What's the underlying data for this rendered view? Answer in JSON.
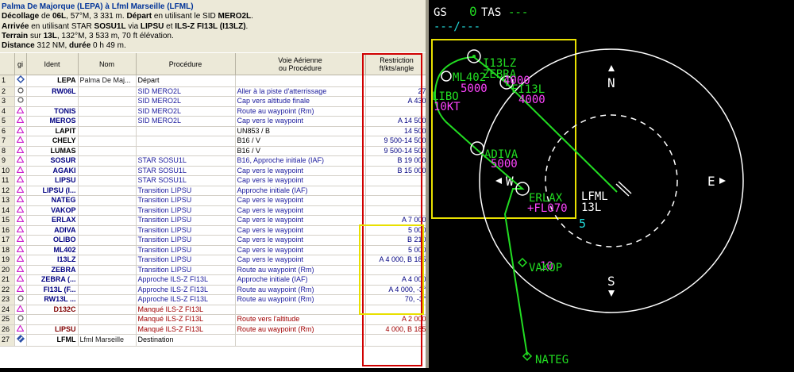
{
  "flightplan": {
    "title": "Palma De Majorque (LEPA) à Lfml Marseille (LFML)",
    "departure": {
      "label": "Décollage",
      "pre": " de ",
      "runway": "06L",
      "info": ", 57°M, 3 331 m. ",
      "label2": "Départ",
      "info2": " en utilisant le SID ",
      "sid": "MERO2L",
      "end": "."
    },
    "arrival": {
      "label": "Arrivée",
      "pre": " en utilisant STAR ",
      "star": "SOSU1L",
      "mid": " via ",
      "via": "LIPSU",
      "and": " et ",
      "approach": "ILS-Z FI13L (I13LZ)",
      "end": "."
    },
    "terrain": {
      "label": "Terrain",
      "pre": " sur ",
      "runway": "13L",
      "info": ", 132°M, 3 533 m, 70 ft élévation."
    },
    "distance": {
      "label": "Distance",
      "value": " 312 NM, ",
      "label2": "durée",
      "value2": " 0 h 49 m."
    }
  },
  "columns": {
    "idx": "",
    "icon": "gi",
    "ident": "Ident",
    "nom": "Nom",
    "procedure": "Procédure",
    "voie1": "Voie Aérienne",
    "voie2": "ou Procédure",
    "restr1": "Restriction",
    "restr2": "ft/kts/angle"
  },
  "rows": [
    {
      "n": "1",
      "icon": "diamond",
      "ident": "LEPA",
      "nom": "Palma De Maj...",
      "proc": "Départ",
      "voie": "",
      "restr": "",
      "pc": "black",
      "vc": "blue",
      "ic": "bk"
    },
    {
      "n": "2",
      "icon": "circle",
      "ident": "RW06L",
      "nom": "",
      "proc": "SID MERO2L",
      "voie": "Aller à la piste d'atterrissage",
      "restr": "27",
      "pc": "blue",
      "vc": "blue",
      "ic": ""
    },
    {
      "n": "3",
      "icon": "circle",
      "ident": "",
      "nom": "",
      "proc": "SID MERO2L",
      "voie": "Cap vers altitude finale",
      "restr": "A 430",
      "pc": "blue",
      "vc": "blue",
      "ic": ""
    },
    {
      "n": "4",
      "icon": "tri",
      "ident": "TONIS",
      "nom": "",
      "proc": "SID MERO2L",
      "voie": "Route au waypoint (Rm)",
      "restr": "",
      "pc": "blue",
      "vc": "blue",
      "ic": ""
    },
    {
      "n": "5",
      "icon": "tri",
      "ident": "MEROS",
      "nom": "",
      "proc": "SID MERO2L",
      "voie": "Cap vers le waypoint",
      "restr": "A 14 500",
      "pc": "blue",
      "vc": "blue",
      "ic": ""
    },
    {
      "n": "6",
      "icon": "tri",
      "ident": "LAPIT",
      "nom": "",
      "proc": "",
      "voie": "UN853 / B",
      "restr": "14 500",
      "pc": "black",
      "vc": "black",
      "ic": "bk"
    },
    {
      "n": "7",
      "icon": "tri",
      "ident": "CHELY",
      "nom": "",
      "proc": "",
      "voie": "B16 / V",
      "restr": "9 500-14 500",
      "pc": "black",
      "vc": "black",
      "ic": "bk"
    },
    {
      "n": "8",
      "icon": "tri",
      "ident": "LUMAS",
      "nom": "",
      "proc": "",
      "voie": "B16 / V",
      "restr": "9 500-14 500",
      "pc": "black",
      "vc": "black",
      "ic": "bk"
    },
    {
      "n": "9",
      "icon": "tri",
      "ident": "SOSUR",
      "nom": "",
      "proc": "STAR SOSU1L",
      "voie": "B16, Approche initiale (IAF)",
      "restr": "B 19 000",
      "pc": "blue",
      "vc": "blue",
      "ic": ""
    },
    {
      "n": "10",
      "icon": "tri",
      "ident": "AGAKI",
      "nom": "",
      "proc": "STAR SOSU1L",
      "voie": "Cap vers le waypoint",
      "restr": "B 15 000",
      "pc": "blue",
      "vc": "blue",
      "ic": ""
    },
    {
      "n": "11",
      "icon": "tri",
      "ident": "LIPSU",
      "nom": "",
      "proc": "STAR SOSU1L",
      "voie": "Cap vers le waypoint",
      "restr": "",
      "pc": "blue",
      "vc": "blue",
      "ic": ""
    },
    {
      "n": "12",
      "icon": "tri",
      "ident": "LIPSU (I...",
      "nom": "",
      "proc": "Transition LIPSU",
      "voie": "Approche initiale (IAF)",
      "restr": "",
      "pc": "blue",
      "vc": "blue",
      "ic": ""
    },
    {
      "n": "13",
      "icon": "tri",
      "ident": "NATEG",
      "nom": "",
      "proc": "Transition LIPSU",
      "voie": "Cap vers le waypoint",
      "restr": "",
      "pc": "blue",
      "vc": "blue",
      "ic": ""
    },
    {
      "n": "14",
      "icon": "tri",
      "ident": "VAKOP",
      "nom": "",
      "proc": "Transition LIPSU",
      "voie": "Cap vers le waypoint",
      "restr": "",
      "pc": "blue",
      "vc": "blue",
      "ic": ""
    },
    {
      "n": "15",
      "icon": "tri",
      "ident": "ERLAX",
      "nom": "",
      "proc": "Transition LIPSU",
      "voie": "Cap vers le waypoint",
      "restr": "A 7 000",
      "pc": "blue",
      "vc": "blue",
      "ic": ""
    },
    {
      "n": "16",
      "icon": "tri",
      "ident": "ADIVA",
      "nom": "",
      "proc": "Transition LIPSU",
      "voie": "Cap vers le waypoint",
      "restr": "5 000",
      "pc": "blue",
      "vc": "blue",
      "ic": ""
    },
    {
      "n": "17",
      "icon": "tri",
      "ident": "OLIBO",
      "nom": "",
      "proc": "Transition LIPSU",
      "voie": "Cap vers le waypoint",
      "restr": "B 210",
      "pc": "blue",
      "vc": "blue",
      "ic": ""
    },
    {
      "n": "18",
      "icon": "tri",
      "ident": "ML402",
      "nom": "",
      "proc": "Transition LIPSU",
      "voie": "Cap vers le waypoint",
      "restr": "5 000",
      "pc": "blue",
      "vc": "blue",
      "ic": ""
    },
    {
      "n": "19",
      "icon": "tri",
      "ident": "I13LZ",
      "nom": "",
      "proc": "Transition LIPSU",
      "voie": "Cap vers le waypoint",
      "restr": "A 4 000, B 185",
      "pc": "blue",
      "vc": "blue",
      "ic": ""
    },
    {
      "n": "20",
      "icon": "tri",
      "ident": "ZEBRA",
      "nom": "",
      "proc": "Transition LIPSU",
      "voie": "Route au waypoint (Rm)",
      "restr": "",
      "pc": "blue",
      "vc": "blue",
      "ic": ""
    },
    {
      "n": "21",
      "icon": "tri",
      "ident": "ZEBRA (...",
      "nom": "",
      "proc": "Approche ILS-Z FI13L",
      "voie": "Approche initiale (IAF)",
      "restr": "A 4 000",
      "pc": "blue",
      "vc": "blue",
      "ic": ""
    },
    {
      "n": "22",
      "icon": "tri",
      "ident": "FI13L (F...",
      "nom": "",
      "proc": "Approche ILS-Z FI13L",
      "voie": "Route au waypoint (Rm)",
      "restr": "A 4 000, -3°",
      "pc": "blue",
      "vc": "blue",
      "ic": ""
    },
    {
      "n": "23",
      "icon": "circle",
      "ident": "RW13L ...",
      "nom": "",
      "proc": "Approche ILS-Z FI13L",
      "voie": "Route au waypoint (Rm)",
      "restr": "70, -3°",
      "pc": "blue",
      "vc": "blue",
      "ic": ""
    },
    {
      "n": "24",
      "icon": "tri",
      "ident": "D132C",
      "nom": "",
      "proc": "Manqué ILS-Z FI13L",
      "voie": "",
      "restr": "",
      "pc": "red",
      "vc": "red",
      "ic": "dk"
    },
    {
      "n": "25",
      "icon": "circle",
      "ident": "",
      "nom": "",
      "proc": "Manqué ILS-Z FI13L",
      "voie": "Route vers l'altitude",
      "restr": "A 2 000",
      "pc": "red",
      "vc": "red",
      "ic": "dk"
    },
    {
      "n": "26",
      "icon": "tri",
      "ident": "LIPSU",
      "nom": "",
      "proc": "Manqué ILS-Z FI13L",
      "voie": "Route au waypoint (Rm)",
      "restr": "4 000, B 185",
      "pc": "red",
      "vc": "red",
      "ic": "dk"
    },
    {
      "n": "27",
      "icon": "airport",
      "ident": "LFML",
      "nom": "Lfml Marseille",
      "proc": "Destination",
      "voie": "",
      "restr": "",
      "pc": "black",
      "vc": "black",
      "ic": "bk"
    }
  ],
  "nd": {
    "gs_label": "GS",
    "gs_value": "0",
    "tas_label": "TAS",
    "tas_value": "---",
    "wind": "---/---",
    "compass": {
      "n": "N",
      "e": "E",
      "s": "S",
      "w": "W"
    },
    "range_ring": "5",
    "airport": "LFML",
    "airport_rwy": "13L",
    "waypoints": [
      {
        "id": "I13LZ",
        "alt": ""
      },
      {
        "id": "ZEBRA",
        "alt": "4000"
      },
      {
        "id": "ML402",
        "alt": "5000"
      },
      {
        "id": "FI13L",
        "alt": "4000"
      },
      {
        "id": "LIBO",
        "alt": "10KT"
      },
      {
        "id": "ADIVA",
        "alt": "5000"
      },
      {
        "id": "ERLAX",
        "alt": "+FL070"
      },
      {
        "id": "VAKOP",
        "alt": ""
      },
      {
        "id": "NATEG",
        "alt": ""
      }
    ],
    "vakop_alt_fragment": "10",
    "colors": {
      "green": "#22dd22",
      "magenta": "#ff44ff",
      "white": "#ffffff",
      "cyan": "#22dddd",
      "yellow": "#e8e000"
    }
  }
}
